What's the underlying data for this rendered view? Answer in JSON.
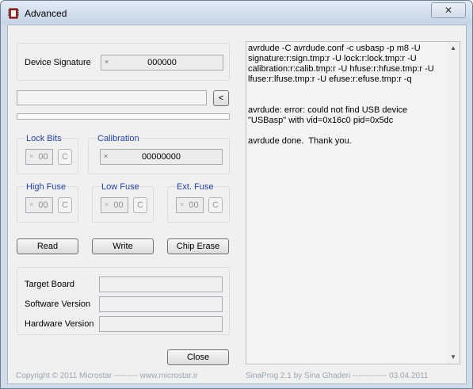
{
  "window": {
    "title": "Advanced",
    "close_glyph": "✕"
  },
  "device_signature": {
    "label": "Device Signature",
    "prefix": "×",
    "value": "000000"
  },
  "selector": {
    "value": "",
    "button_label": "<"
  },
  "lock_bits": {
    "label": "Lock Bits",
    "prefix": "×",
    "value": "00",
    "button_label": "C"
  },
  "calibration": {
    "label": "Calibration",
    "prefix": "×",
    "value": "00000000"
  },
  "high_fuse": {
    "label": "High Fuse",
    "prefix": "×",
    "value": "00",
    "button_label": "C"
  },
  "low_fuse": {
    "label": "Low Fuse",
    "prefix": "×",
    "value": "00",
    "button_label": "C"
  },
  "ext_fuse": {
    "label": "Ext. Fuse",
    "prefix": "×",
    "value": "00",
    "button_label": "C"
  },
  "actions": {
    "read": "Read",
    "write": "Write",
    "chip_erase": "Chip Erase"
  },
  "info": {
    "target_board": {
      "label": "Target Board",
      "value": ""
    },
    "software_version": {
      "label": "Software Version",
      "value": ""
    },
    "hardware_version": {
      "label": "Hardware Version",
      "value": ""
    }
  },
  "close_button": "Close",
  "log": {
    "text": "avrdude -C avrdude.conf -c usbasp -p m8 -U signature:r:sign.tmp:r -U lock:r:lock.tmp:r -U calibration:r:calib.tmp:r -U hfuse:r:hfuse.tmp:r -U lfuse:r:lfuse.tmp:r -U efuse:r:efuse.tmp:r -q\n\n\navrdude: error: could not find USB device \"USBasp\" with vid=0x16c0 pid=0x5dc\n\navrdude done.  Thank you.",
    "scroll_up": "▲",
    "scroll_down": "▼"
  },
  "footer": {
    "left": "Copyright © 2011 Microstar  ---------   www.microstar.ir",
    "right": "SinaProg 2.1  by  Sina Ghaderi   -------------   03.04.2011"
  }
}
